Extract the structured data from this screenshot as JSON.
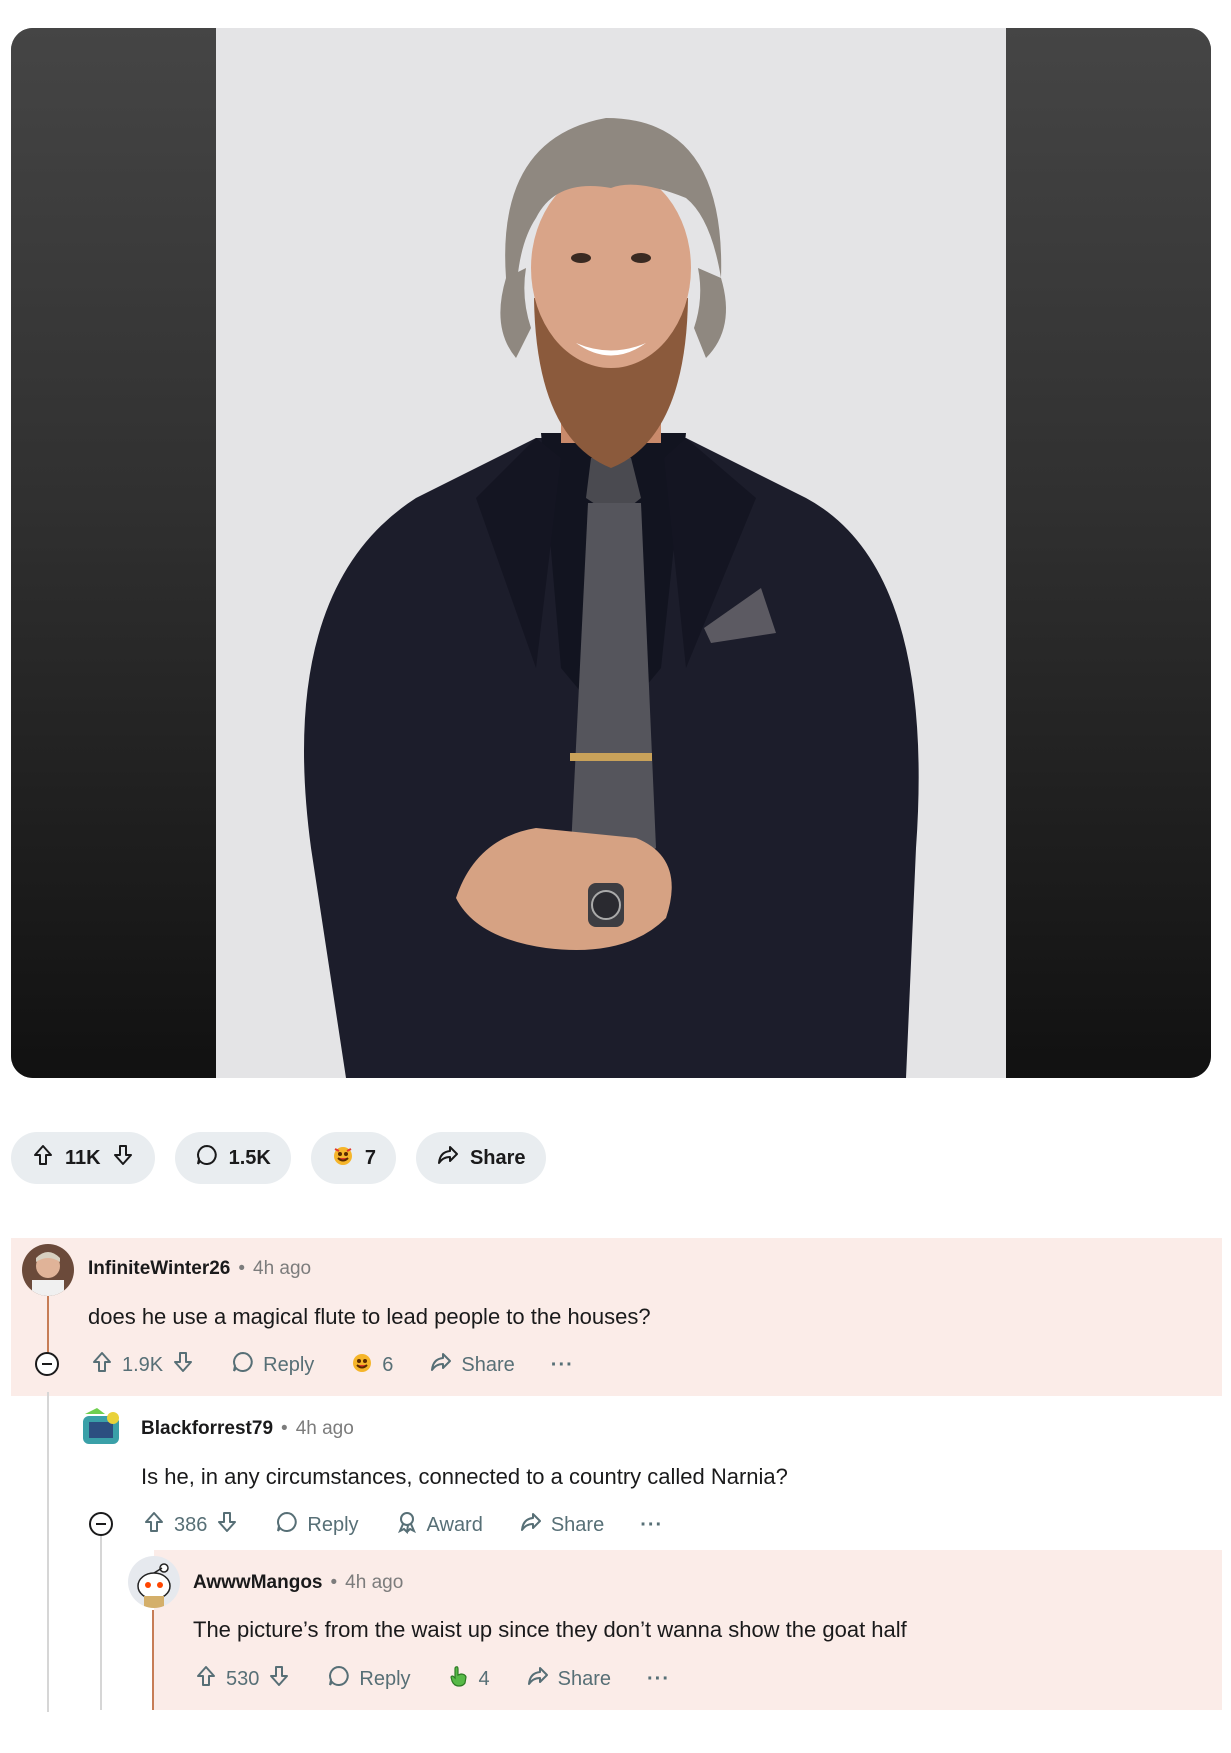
{
  "post": {
    "upvotes": "11K",
    "comments": "1.5K",
    "awards": "7",
    "share_label": "Share"
  },
  "comments": [
    {
      "user": "InfiniteWinter26",
      "time": "4h ago",
      "text": "does he use a magical flute to lead people to the houses?",
      "score": "1.9K",
      "reply_label": "Reply",
      "award_count": "6",
      "share_label": "Share",
      "more": "···"
    },
    {
      "user": "Blackforrest79",
      "time": "4h ago",
      "text": "Is he, in any circumstances, connected to a country called Narnia?",
      "score": "386",
      "reply_label": "Reply",
      "award_label": "Award",
      "share_label": "Share",
      "more": "···"
    },
    {
      "user": "AwwwMangos",
      "time": "4h ago",
      "text": "The picture’s from the waist up since they don’t wanna show the goat half",
      "score": "530",
      "reply_label": "Reply",
      "award_count": "4",
      "share_label": "Share",
      "more": "···"
    }
  ],
  "separator": "•",
  "colors": {
    "pill_bg": "#e9edf0",
    "highlight_bg": "#fbece8",
    "thread_accent": "#c77d56",
    "meta_gray": "#7c7c7c"
  }
}
